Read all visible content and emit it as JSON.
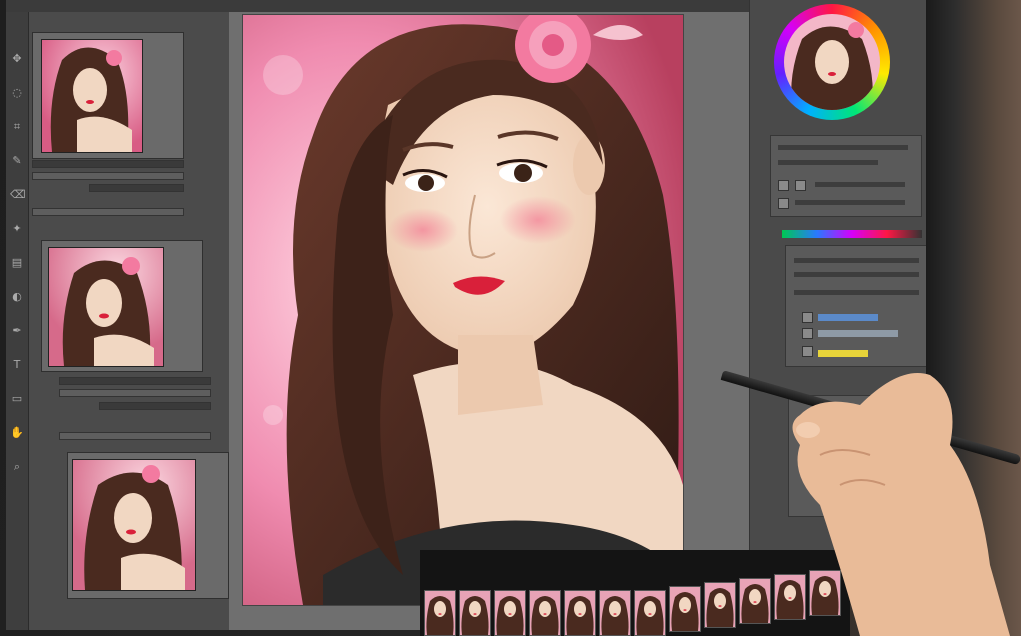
{
  "app": {
    "window_title": "",
    "menus": []
  },
  "colors": {
    "panel_dark": "#3e3e3e",
    "panel_mid": "#4b4b4b",
    "workspace": "#6f6f6f",
    "accent_pink": "#f29ab8",
    "skin": "#f1d7c2",
    "hair": "#4a2a1f",
    "lips": "#d9203a",
    "rose": "#f37aa0"
  },
  "tools": [
    "move-icon",
    "lasso-icon",
    "crop-icon",
    "brush-icon",
    "eraser-icon",
    "stamp-icon",
    "gradient-icon",
    "dodge-icon",
    "pen-icon",
    "text-icon",
    "shape-icon",
    "hand-icon",
    "zoom-icon"
  ],
  "layers_panel": {
    "thumbnails": [
      {
        "name": "portrait-variant-1"
      },
      {
        "name": "portrait-variant-2"
      },
      {
        "name": "portrait-variant-3"
      }
    ]
  },
  "canvas": {
    "subject": "portrait"
  },
  "right_panel": {
    "color_wheel": true
  },
  "filmstrip": {
    "count": 12
  }
}
